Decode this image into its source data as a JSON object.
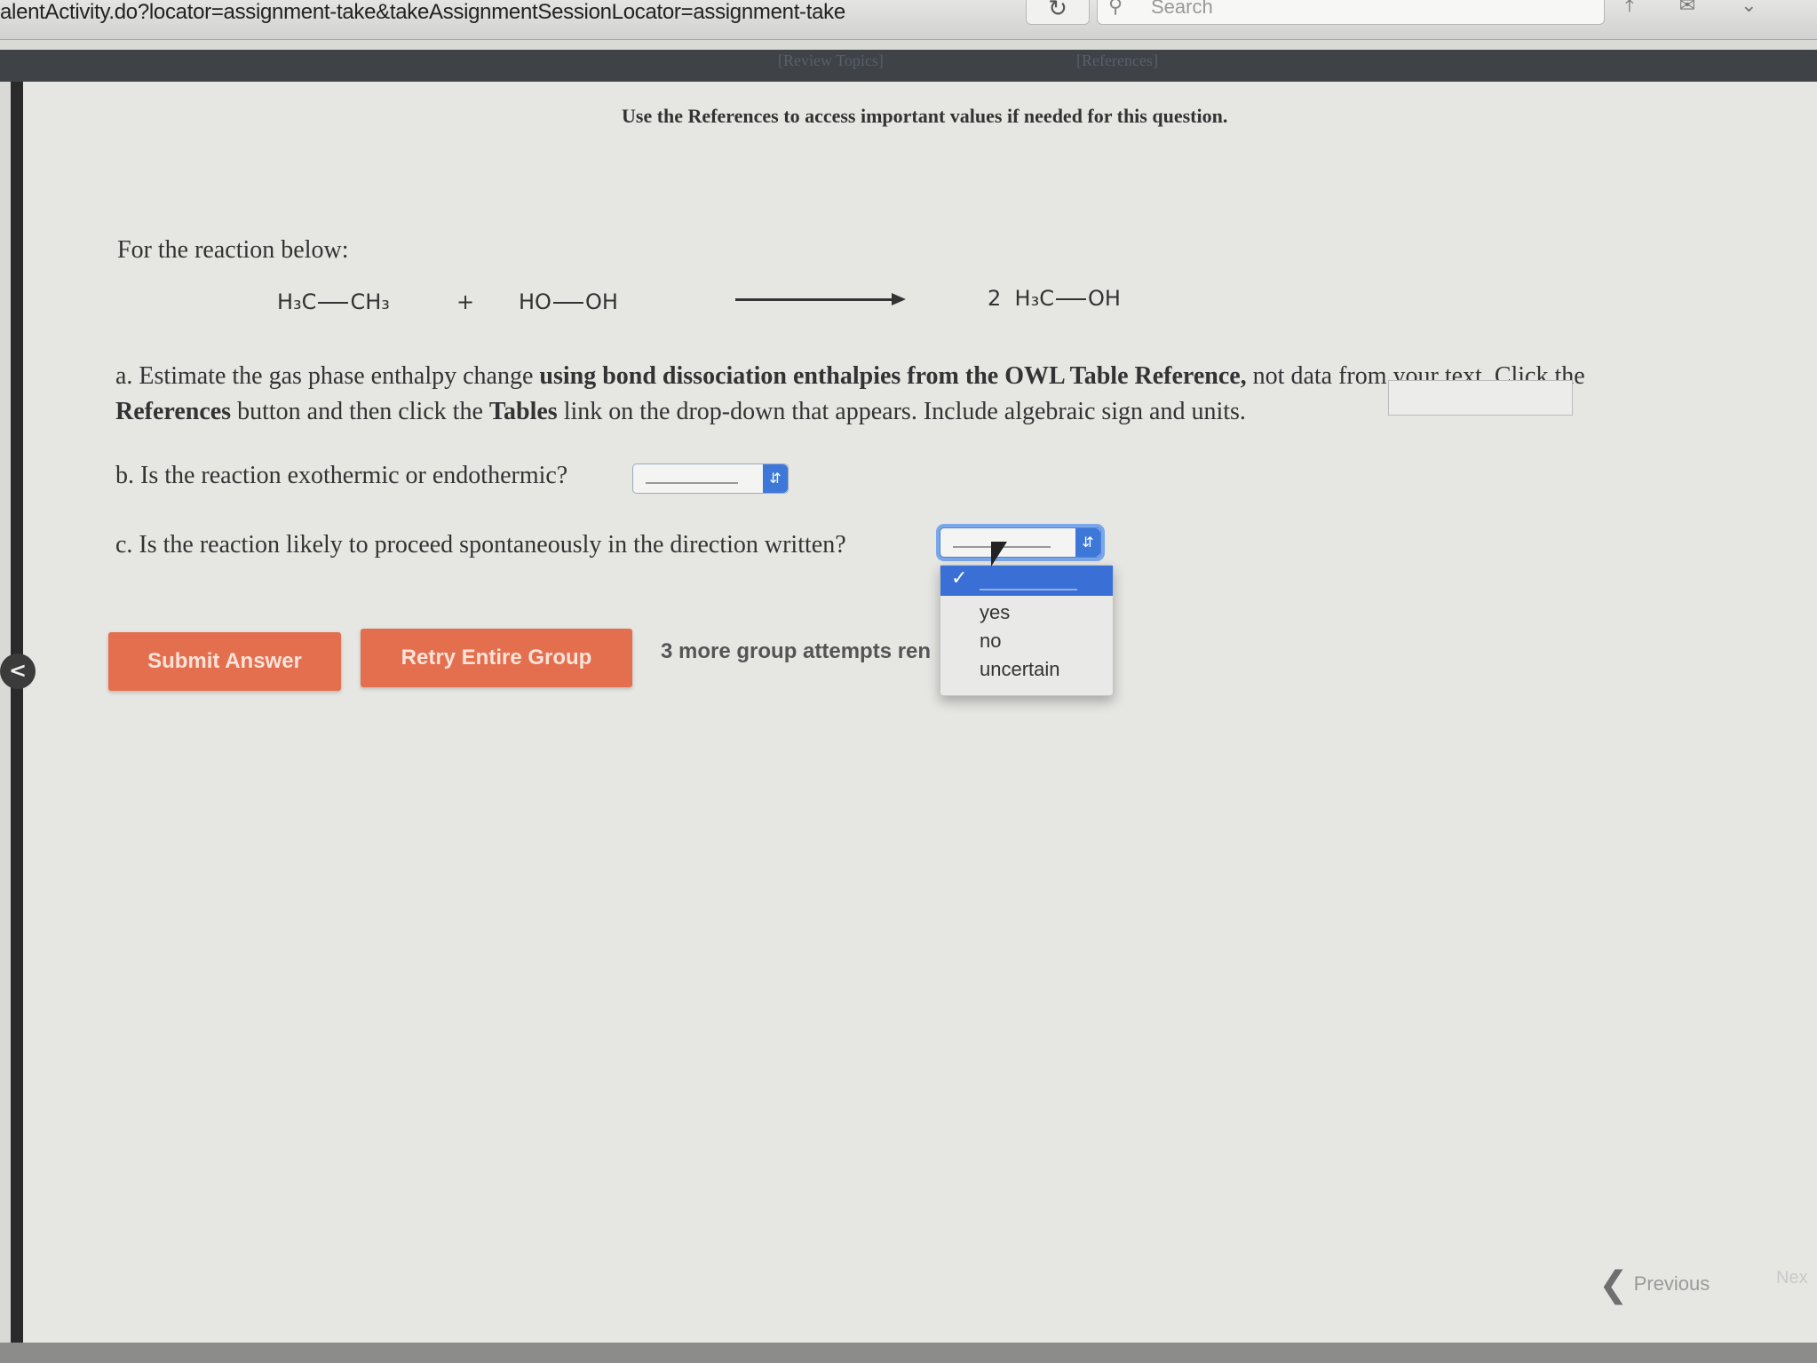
{
  "browser": {
    "url": "alentActivity.do?locator=assignment-take&takeAssignmentSessionLocator=assignment-take",
    "reload_glyph": "↻",
    "search_icon": "search-icon",
    "search_placeholder": "Search",
    "toolbar_glyphs": "⤒ ✉ ⌄"
  },
  "nav": {
    "review_topics": "[Review Topics]",
    "references": "[References]"
  },
  "question": {
    "notice": "Use the References to access important values if needed for this question.",
    "intro": "For the reaction below:",
    "reaction": {
      "reactant1_left": "H₃C",
      "reactant1_right": "CH₃",
      "plus": "+",
      "reactant2_left": "HO",
      "reactant2_right": "OH",
      "product_coef": "2",
      "product_left": "H₃C",
      "product_right": "OH"
    },
    "part_a": {
      "prefix": "a. Estimate the gas phase enthalpy change ",
      "bold1": "using bond dissociation enthalpies from the OWL Table Reference,",
      "mid": " not data from your text. Click the ",
      "bold2": "References",
      "mid2": " button and then click the ",
      "bold3": "Tables",
      "suffix": " link on the drop-down that appears. Include algebraic sign and units.",
      "answer_value": ""
    },
    "part_b": {
      "label": "b. Is the reaction exothermic or endothermic?",
      "selected": ""
    },
    "part_c": {
      "label": "c. Is the reaction likely to proceed spontaneously in the direction written?",
      "selected": "",
      "options": [
        "yes",
        "no",
        "uncertain"
      ],
      "check_glyph": "✓"
    }
  },
  "actions": {
    "submit": "Submit Answer",
    "retry": "Retry Entire Group",
    "attempts": "3 more group attempts ren"
  },
  "footer": {
    "previous": "Previous",
    "previous_chevron": "❮",
    "next": "Nex"
  },
  "side_toggle_glyph": "<",
  "colors": {
    "button_bg": "#e46f4e",
    "select_accent": "#3d78d8",
    "nav_bg": "#3f4246"
  }
}
